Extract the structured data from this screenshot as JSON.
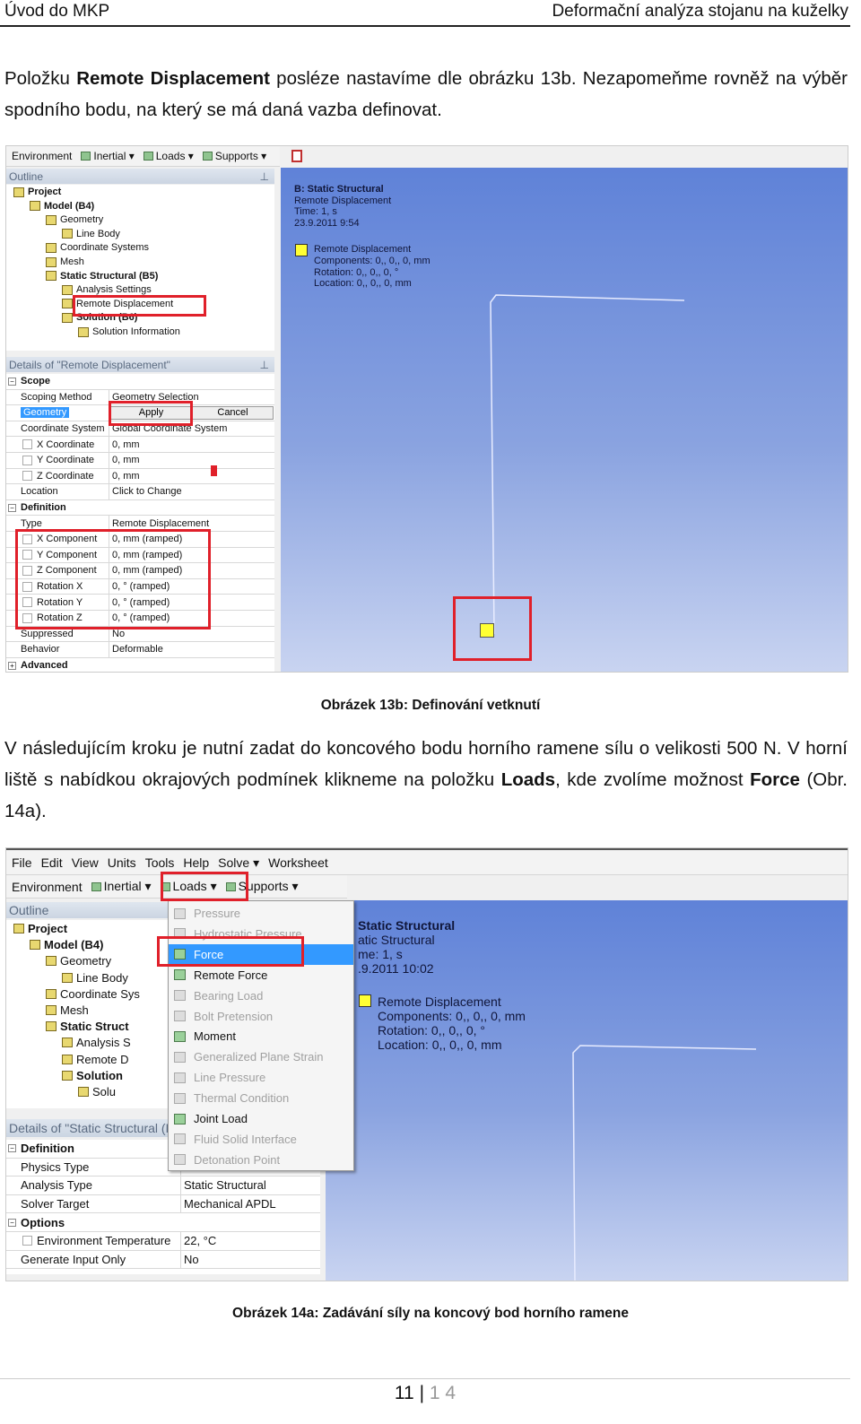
{
  "header": {
    "left": "Úvod do MKP",
    "right": "Deformační analýza stojanu na kuželky"
  },
  "para1": {
    "t1": "Položku ",
    "b1": "Remote Displacement",
    "t2": " posléze nastavíme dle obrázku 13b. Nezapomeňme rovněž na výběr spodního bodu, na který se má daná vazba definovat."
  },
  "fig1": {
    "toolbar": [
      "Environment",
      "Inertial ▾",
      "Loads ▾",
      "Supports ▾"
    ],
    "outline_title": "Outline",
    "tree": [
      {
        "label": "Project",
        "level": 0,
        "bold": true
      },
      {
        "label": "Model (B4)",
        "level": 1,
        "bold": true
      },
      {
        "label": "Geometry",
        "level": 2,
        "bold": false
      },
      {
        "label": "Line Body",
        "level": 3,
        "bold": false
      },
      {
        "label": "Coordinate Systems",
        "level": 2,
        "bold": false
      },
      {
        "label": "Mesh",
        "level": 2,
        "bold": false
      },
      {
        "label": "Static Structural (B5)",
        "level": 2,
        "bold": true
      },
      {
        "label": "Analysis Settings",
        "level": 3,
        "bold": false
      },
      {
        "label": "Remote Displacement",
        "level": 3,
        "bold": false
      },
      {
        "label": "Solution (B6)",
        "level": 3,
        "bold": true
      },
      {
        "label": "Solution Information",
        "level": 4,
        "bold": false
      }
    ],
    "details_title": "Details of \"Remote Displacement\"",
    "details": [
      {
        "label": "Scope",
        "section": true
      },
      {
        "label": "Scoping Method",
        "value": "Geometry Selection"
      },
      {
        "label": "Geometry",
        "value": "Apply",
        "value2": "Cancel",
        "selected": true
      },
      {
        "label": "Coordinate System",
        "value": "Global Coordinate System"
      },
      {
        "label": "X Coordinate",
        "value": "0, mm",
        "checkbox": true
      },
      {
        "label": "Y Coordinate",
        "value": "0, mm",
        "checkbox": true
      },
      {
        "label": "Z Coordinate",
        "value": "0, mm",
        "checkbox": true
      },
      {
        "label": "Location",
        "value": "Click to Change"
      },
      {
        "label": "Definition",
        "section": true
      },
      {
        "label": "Type",
        "value": "Remote Displacement"
      },
      {
        "label": "X Component",
        "value": "0, mm  (ramped)",
        "checkbox": true
      },
      {
        "label": "Y Component",
        "value": "0, mm  (ramped)",
        "checkbox": true
      },
      {
        "label": "Z Component",
        "value": "0, mm  (ramped)",
        "checkbox": true
      },
      {
        "label": "Rotation X",
        "value": "0, °  (ramped)",
        "checkbox": true
      },
      {
        "label": "Rotation Y",
        "value": "0, °  (ramped)",
        "checkbox": true
      },
      {
        "label": "Rotation Z",
        "value": "0, °  (ramped)",
        "checkbox": true
      },
      {
        "label": "Suppressed",
        "value": "No"
      },
      {
        "label": "Behavior",
        "value": "Deformable"
      },
      {
        "label": "Advanced",
        "section": true,
        "collapsed": true
      }
    ],
    "viewport": {
      "title": "B: Static Structural",
      "lines": [
        "Remote Displacement",
        "Time: 1, s",
        "23.9.2011 9:54"
      ],
      "legend_title": "Remote Displacement",
      "legend_lines": [
        "Components: 0,, 0,, 0, mm",
        "Rotation: 0,, 0,, 0, °",
        "Location: 0,, 0,, 0, mm"
      ],
      "legend_color": "#ffff33"
    }
  },
  "caption1": "Obrázek 13b: Definování vetknutí",
  "para2": {
    "t1": "V následujícím kroku je nutní zadat do koncového bodu horního ramene sílu o velikosti 500 N. V horní liště s nabídkou okrajových podmínek klikneme na položku ",
    "b1": "Loads",
    "t2": ", kde zvolíme možnost ",
    "b2": "Force",
    "t3": " (Obr. 14a)."
  },
  "fig2": {
    "menubar": [
      "File",
      "Edit",
      "View",
      "Units",
      "Tools",
      "Help",
      "Solve ▾",
      "Worksheet"
    ],
    "toolbar": [
      "Environment",
      "Inertial ▾",
      "Loads ▾",
      "Supports ▾"
    ],
    "outline_title": "Outline",
    "tree": [
      {
        "label": "Project",
        "level": 0,
        "bold": true
      },
      {
        "label": "Model (B4)",
        "level": 1,
        "bold": true
      },
      {
        "label": "Geometry",
        "level": 2,
        "bold": false
      },
      {
        "label": "Line Body",
        "level": 3,
        "bold": false
      },
      {
        "label": "Coordinate Sys",
        "level": 2,
        "bold": false
      },
      {
        "label": "Mesh",
        "level": 2,
        "bold": false
      },
      {
        "label": "Static Struct",
        "level": 2,
        "bold": true
      },
      {
        "label": "Analysis S",
        "level": 3,
        "bold": false
      },
      {
        "label": "Remote D",
        "level": 3,
        "bold": false
      },
      {
        "label": "Solution",
        "level": 3,
        "bold": true
      },
      {
        "label": "Solu",
        "level": 4,
        "bold": false
      }
    ],
    "menu": [
      {
        "label": "Pressure",
        "enabled": false
      },
      {
        "label": "Hydrostatic Pressure",
        "enabled": false
      },
      {
        "label": "Force",
        "enabled": true,
        "highlighted": true
      },
      {
        "label": "Remote Force",
        "enabled": true
      },
      {
        "label": "Bearing Load",
        "enabled": false
      },
      {
        "label": "Bolt Pretension",
        "enabled": false
      },
      {
        "label": "Moment",
        "enabled": true
      },
      {
        "label": "Generalized Plane Strain",
        "enabled": false
      },
      {
        "label": "Line Pressure",
        "enabled": false
      },
      {
        "label": "Thermal Condition",
        "enabled": false
      },
      {
        "label": "Joint Load",
        "enabled": true
      },
      {
        "label": "Fluid Solid Interface",
        "enabled": false
      },
      {
        "label": "Detonation Point",
        "enabled": false
      }
    ],
    "details_title": "Details of \"Static Structural (B",
    "details": [
      {
        "label": "Definition",
        "section": true
      },
      {
        "label": "Physics Type",
        "value": ""
      },
      {
        "label": "Analysis Type",
        "value": "Static Structural"
      },
      {
        "label": "Solver Target",
        "value": "Mechanical APDL"
      },
      {
        "label": "Options",
        "section": true
      },
      {
        "label": "Environment Temperature",
        "value": "22, °C",
        "checkbox": true
      },
      {
        "label": "Generate Input Only",
        "value": "No"
      }
    ],
    "viewport": {
      "title": "Static Structural",
      "lines": [
        "atic Structural",
        "me: 1, s",
        ".9.2011 10:02"
      ],
      "legend_title": "Remote Displacement",
      "legend_lines": [
        "Components: 0,, 0,, 0, mm",
        "Rotation: 0,, 0,, 0, °",
        "Location: 0,, 0,, 0, mm"
      ],
      "legend_color": "#ffff33"
    }
  },
  "caption2": "Obrázek 14a: Zadávání síly na koncový bod horního ramene",
  "footer": {
    "page": "11",
    "sep": "|",
    "total": "1 4"
  },
  "colors": {
    "highlight": "#3399ff",
    "annotation": "#e0202a"
  }
}
